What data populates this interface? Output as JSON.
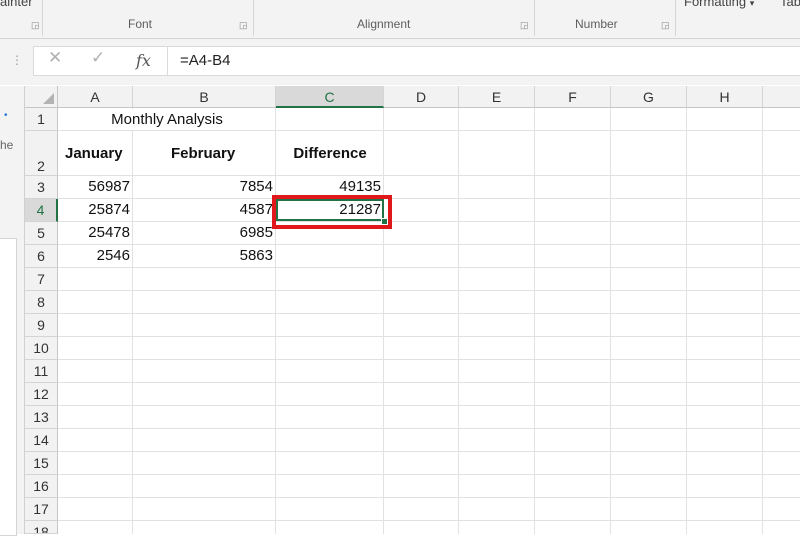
{
  "ribbon": {
    "clipboard_fragment": "ainter",
    "groups": [
      {
        "label": "Font"
      },
      {
        "label": "Alignment"
      },
      {
        "label": "Number"
      }
    ],
    "formatting_dropdown": "Formatting",
    "table_fragment": "Tab"
  },
  "formula_bar": {
    "cancel_icon": "✕",
    "enter_icon": "✓",
    "fx_label": "fx",
    "formula": "=A4-B4"
  },
  "left_pane": {
    "fragment": "he"
  },
  "sheet": {
    "columns": [
      "A",
      "B",
      "C",
      "D",
      "E",
      "F",
      "G",
      "H"
    ],
    "selected_column": "C",
    "rows": [
      "1",
      "2",
      "3",
      "4",
      "5",
      "6",
      "7",
      "8",
      "9",
      "10",
      "11",
      "12",
      "13",
      "14",
      "15",
      "16",
      "17",
      "18"
    ],
    "selected_row": "4",
    "title": "Monthly Analysis",
    "headers": {
      "a": "January",
      "b": "February",
      "c": "Difference"
    },
    "data": [
      {
        "a": "56987",
        "b": "7854",
        "c": "49135"
      },
      {
        "a": "25874",
        "b": "4587",
        "c": "21287"
      },
      {
        "a": "25478",
        "b": "6985",
        "c": ""
      },
      {
        "a": "2546",
        "b": "5863",
        "c": ""
      }
    ],
    "active_cell": "C4"
  },
  "colors": {
    "accent": "#217346",
    "highlight_box": "#e0181b"
  }
}
